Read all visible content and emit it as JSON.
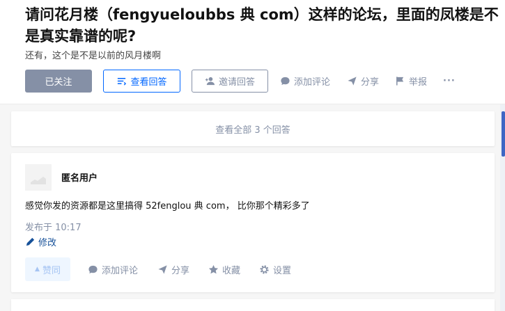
{
  "question": {
    "title": "请问花月楼（fengyueloubbs 典 com）这样的论坛，里面的凤楼是不是真实靠谱的呢?",
    "detail": "还有，这个是不是以前的风月楼啊"
  },
  "actions": {
    "followed_label": "已关注",
    "view_answers_label": "查看回答",
    "invite_label": "邀请回答",
    "add_comment_label": "添加评论",
    "share_label": "分享",
    "report_label": "举报",
    "more_label": "···"
  },
  "answers_bar": {
    "label": "查看全部 3 个回答"
  },
  "answer": {
    "author": "匿名用户",
    "content": "感觉你发的资源都是这里搞得 52fenglou 典 com， 比你那个精彩多了",
    "time": "发布于 10:17",
    "edit_label": "修改",
    "vote_label": "赞同",
    "comment_label": "添加评论",
    "share_label": "分享",
    "collect_label": "收藏",
    "settings_label": "设置"
  },
  "colors": {
    "accent": "#0066ff",
    "muted": "#8590a6",
    "link": "#175199"
  }
}
